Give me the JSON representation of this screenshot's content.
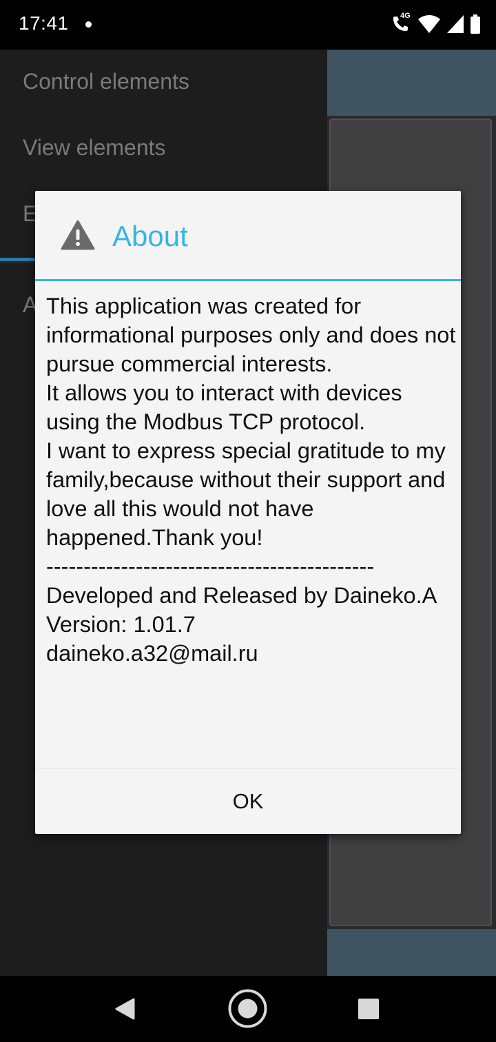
{
  "status_bar": {
    "time": "17:41",
    "network": "4G",
    "icons": [
      "notification-dot-icon",
      "volte-call-icon",
      "wifi-icon",
      "cell-signal-icon",
      "battery-icon"
    ]
  },
  "drawer": {
    "items": [
      {
        "label": "Control elements"
      },
      {
        "label": "View elements"
      },
      {
        "label": "E"
      },
      {
        "label": "A"
      }
    ]
  },
  "dialog": {
    "icon": "warning-icon",
    "title": "About",
    "message": "This application was created for informational purposes only and does not pursue commercial interests.\nIt allows you to interact with devices using the Modbus TCP protocol.\nI want to express special gratitude to my family,because without their support and love all this would not have happened.Thank you!\n--------------------------------------------\nDeveloped and Released by Daineko.A\nVersion: 1.01.7\ndaineko.a32@mail.ru",
    "ok_label": "OK"
  },
  "colors": {
    "accent": "#33b5e5",
    "dialog_bg": "#f4f4f4",
    "drawer_bg": "#1d1d1d",
    "toolbar": "#3f5461"
  },
  "nav_bar": {
    "icons": [
      "back-icon",
      "home-icon",
      "recents-icon"
    ]
  }
}
